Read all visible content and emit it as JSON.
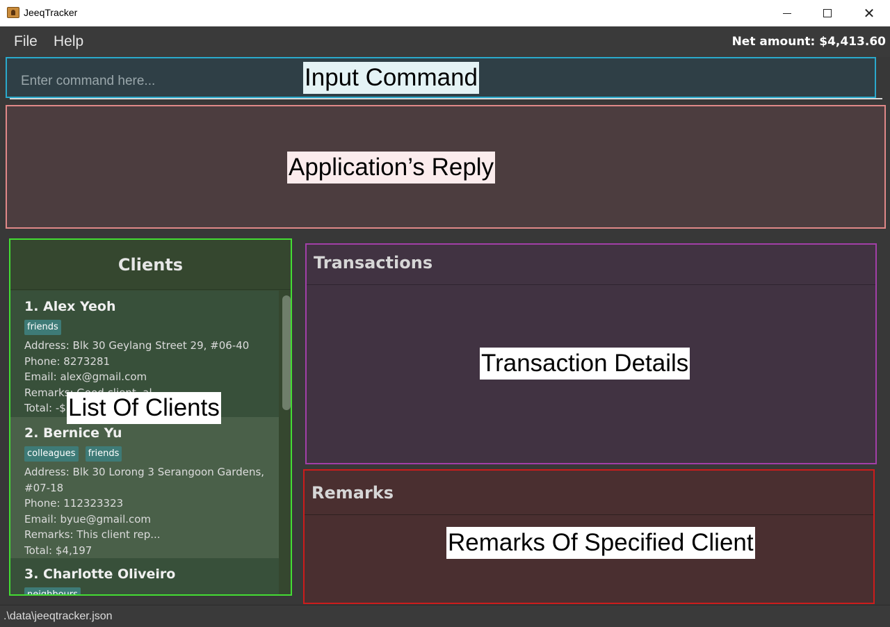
{
  "window": {
    "title": "JeeqTracker"
  },
  "menu": {
    "file": "File",
    "help": "Help",
    "net_amount": "Net amount: $4,413.60"
  },
  "command": {
    "placeholder": "Enter command here..."
  },
  "annotations": {
    "input": "Input Command",
    "reply": "Application’s Reply",
    "clients": "List Of Clients",
    "transactions": "Transaction Details",
    "remarks": "Remarks Of Specified Client"
  },
  "clients": {
    "title": "Clients",
    "items": [
      {
        "name": "1.  Alex Yeoh",
        "tags": [
          "friends"
        ],
        "address": "Address: Blk 30 Geylang Street 29, #06-40",
        "phone": "Phone: 8273281",
        "email": "Email: alex@gmail.com",
        "remarks": "Remarks: Good client, al...",
        "total": "Total: -$1"
      },
      {
        "name": "2.  Bernice Yu",
        "tags": [
          "colleagues",
          "friends"
        ],
        "address": "Address: Blk 30 Lorong 3 Serangoon Gardens, #07-18",
        "phone": "Phone: 112323323",
        "email": "Email: byue@gmail.com",
        "remarks": "Remarks: This client rep...",
        "total": "Total: $4,197"
      },
      {
        "name": "3.  Charlotte Oliveiro",
        "tags": [
          "neighbours"
        ]
      }
    ]
  },
  "transactions": {
    "title": "Transactions"
  },
  "remarks": {
    "title": "Remarks"
  },
  "status": {
    "path": ".\\data\\jeeqtracker.json"
  }
}
